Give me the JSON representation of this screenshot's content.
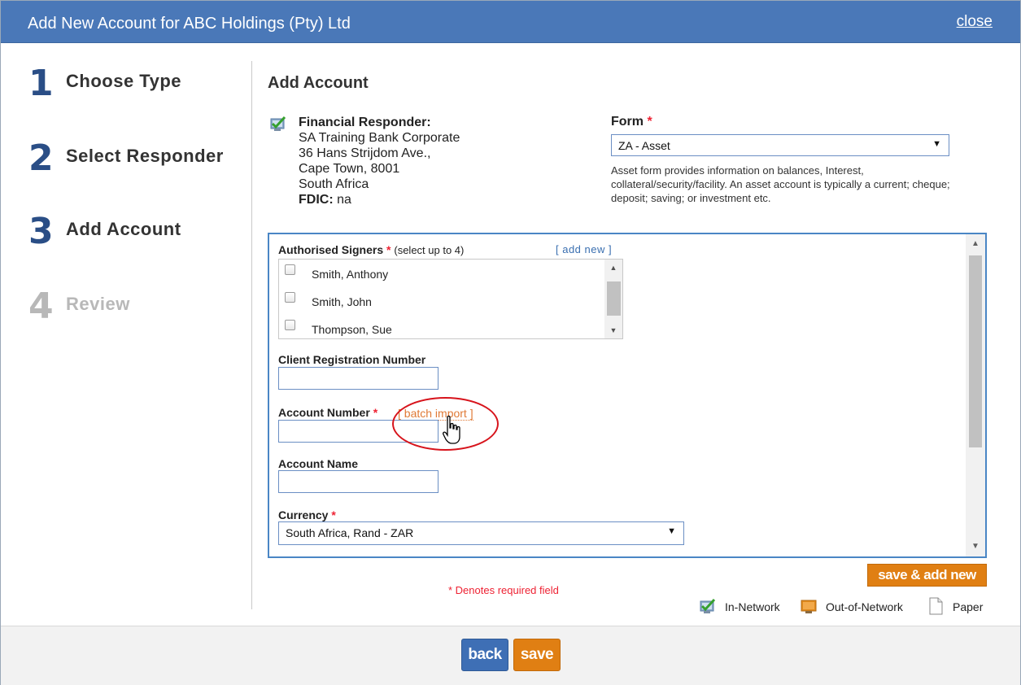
{
  "dialog": {
    "title": "Add New Account for ABC Holdings (Pty) Ltd",
    "close_label": "close"
  },
  "steps": [
    {
      "num": "1",
      "label": "Choose Type",
      "state": "done"
    },
    {
      "num": "2",
      "label": "Select Responder",
      "state": "done"
    },
    {
      "num": "3",
      "label": "Add Account",
      "state": "current"
    },
    {
      "num": "4",
      "label": "Review",
      "state": "disabled"
    }
  ],
  "main": {
    "heading": "Add Account",
    "responder": {
      "icon": "in-network-icon",
      "label": "Financial Responder:",
      "lines": [
        "SA Training Bank Corporate",
        "36 Hans Strijdom Ave.,",
        "Cape Town, 8001",
        "South Africa"
      ],
      "fdic_label": "FDIC:",
      "fdic_value": "na"
    },
    "form": {
      "label": "Form",
      "required_mark": "*",
      "selected": "ZA - Asset",
      "description": "Asset form provides information on balances, Interest, collateral/security/facility. An asset account is typically a current; cheque; deposit; saving; or investment etc."
    }
  },
  "fields": {
    "signers": {
      "label": "Authorised Signers",
      "required_mark": "*",
      "note": "(select up to 4)",
      "add_new": "[ add new ]",
      "items": [
        {
          "name": "Smith, Anthony",
          "checked": false
        },
        {
          "name": "Smith, John",
          "checked": false
        },
        {
          "name": "Thompson, Sue",
          "checked": false
        }
      ]
    },
    "client_reg": {
      "label": "Client Registration Number",
      "value": ""
    },
    "account_number": {
      "label": "Account Number",
      "required_mark": "*",
      "value": "",
      "batch_import": "[ batch import ]"
    },
    "account_name": {
      "label": "Account Name",
      "value": ""
    },
    "currency": {
      "label": "Currency",
      "required_mark": "*",
      "selected": "South Africa, Rand - ZAR"
    }
  },
  "actions": {
    "save_add_new": "save & add new",
    "required_note": "* Denotes required field",
    "back": "back",
    "save": "save"
  },
  "legend": [
    {
      "icon": "in-network-icon",
      "label": "In-Network"
    },
    {
      "icon": "out-of-network-icon",
      "label": "Out-of-Network"
    },
    {
      "icon": "paper-icon",
      "label": "Paper"
    }
  ],
  "colors": {
    "title_bar": "#4a78b8",
    "step_number": "#2a4e86",
    "accent_orange": "#e07f13",
    "back_button": "#3e6fb5",
    "required": "#ee2233",
    "highlight_circle": "#d7141c"
  }
}
